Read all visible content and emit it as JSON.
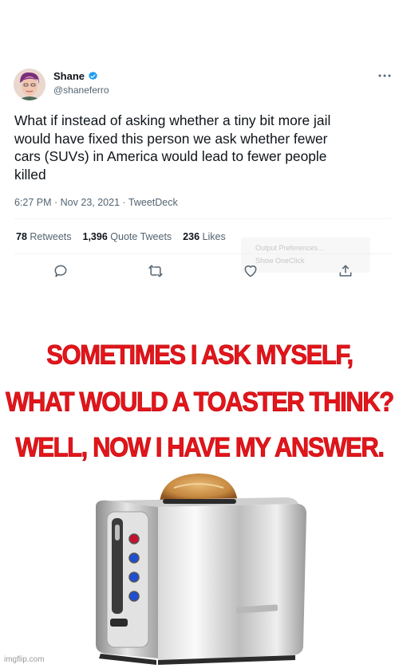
{
  "tweet": {
    "display_name": "Shane",
    "handle": "@shaneferro",
    "text_lines": [
      "What if instead of asking whether a tiny bit more jail",
      "would have fixed this person we ask whether fewer",
      "cars (SUVs) in America would lead to fewer people",
      "killed"
    ],
    "meta": "6:27 PM · Nov 23, 2021 · TweetDeck",
    "stats": {
      "retweets_count": "78",
      "retweets_label": "Retweets",
      "quotes_count": "1,396",
      "quotes_label": "Quote Tweets",
      "likes_count": "236",
      "likes_label": "Likes"
    }
  },
  "context_menu": {
    "items": [
      "Output Preferences...",
      "Show OneClick"
    ]
  },
  "meme": {
    "lines": [
      "SOMETIMES I ASK MYSELF,",
      "WHAT WOULD A TOASTER THINK?",
      "WELL, NOW I HAVE MY ANSWER."
    ],
    "color": "#e4161b"
  },
  "watermark": "imgflip.com",
  "icons": [
    "more-icon",
    "verified-icon",
    "reply-icon",
    "retweet-icon",
    "like-icon",
    "share-icon",
    "toaster-image"
  ]
}
